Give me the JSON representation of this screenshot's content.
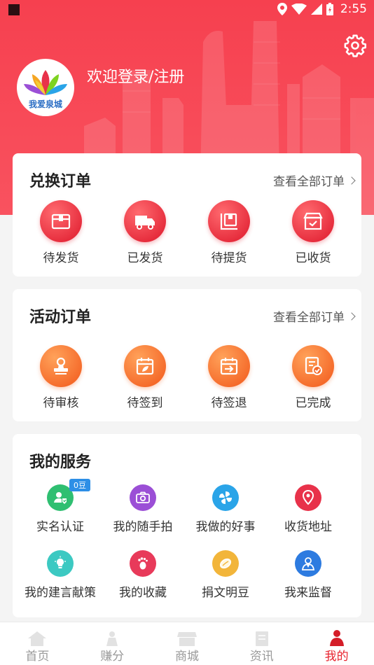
{
  "status_bar": {
    "time": "2:55"
  },
  "header": {
    "avatar_text": "我爱泉城",
    "login_text": "欢迎登录/注册"
  },
  "exchange_orders": {
    "title": "兑换订单",
    "view_all": "查看全部订单",
    "items": [
      {
        "label": "待发货",
        "icon": "box-icon"
      },
      {
        "label": "已发货",
        "icon": "truck-icon"
      },
      {
        "label": "待提货",
        "icon": "pickup-icon"
      },
      {
        "label": "已收货",
        "icon": "received-box-icon"
      }
    ]
  },
  "activity_orders": {
    "title": "活动订单",
    "view_all": "查看全部订单",
    "items": [
      {
        "label": "待审核",
        "icon": "stamp-icon"
      },
      {
        "label": "待签到",
        "icon": "calendar-leaf-icon"
      },
      {
        "label": "待签退",
        "icon": "calendar-arrow-icon"
      },
      {
        "label": "已完成",
        "icon": "document-check-icon"
      }
    ]
  },
  "services": {
    "title": "我的服务",
    "badge": "0豆",
    "items": [
      {
        "label": "实名认证",
        "icon": "id-verify-icon",
        "color": "#2fbf71"
      },
      {
        "label": "我的随手拍",
        "icon": "camera-icon",
        "color": "#9b4fd6"
      },
      {
        "label": "我做的好事",
        "icon": "pinwheel-icon",
        "color": "#2aa4e8"
      },
      {
        "label": "收货地址",
        "icon": "location-pin-icon",
        "color": "#e8324a"
      },
      {
        "label": "我的建言献策",
        "icon": "lightbulb-icon",
        "color": "#3cc9c2"
      },
      {
        "label": "我的收藏",
        "icon": "footprint-icon",
        "color": "#e83a5a"
      },
      {
        "label": "捐文明豆",
        "icon": "bean-icon",
        "color": "#f2b53a"
      },
      {
        "label": "我来监督",
        "icon": "supervisor-icon",
        "color": "#2d7be0"
      }
    ]
  },
  "bottom_nav": {
    "items": [
      {
        "label": "首页",
        "icon": "home-icon"
      },
      {
        "label": "赚分",
        "icon": "earn-icon"
      },
      {
        "label": "商城",
        "icon": "shop-icon"
      },
      {
        "label": "资讯",
        "icon": "news-icon"
      },
      {
        "label": "我的",
        "icon": "profile-icon"
      }
    ],
    "active_color": "#e8242f"
  }
}
